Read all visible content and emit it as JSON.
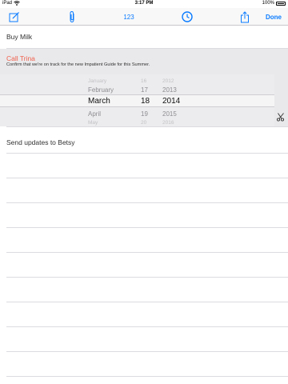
{
  "status_bar": {
    "carrier": "iPad",
    "time": "3:17 PM",
    "battery": "100%"
  },
  "toolbar": {
    "compose_icon": "compose-icon",
    "attach_icon": "paperclip-icon",
    "count_label": "123",
    "clock_icon": "clock-icon",
    "share_icon": "share-icon",
    "done_label": "Done",
    "accent_color": "#0a7bff"
  },
  "tasks": [
    {
      "title": "Buy Milk"
    },
    {
      "title": "Call Trina",
      "note": "Confirm that we're on track for the new Impatient Guide for this Summer.",
      "title_color": "#f0604d"
    },
    {
      "title": "Send updates to Betsy"
    }
  ],
  "date_picker": {
    "months": [
      "January",
      "February",
      "March",
      "April",
      "May"
    ],
    "days": [
      "16",
      "17",
      "18",
      "19",
      "20"
    ],
    "years": [
      "2012",
      "2013",
      "2014",
      "2015",
      "2016"
    ],
    "selected_month": "March",
    "selected_day": "18",
    "selected_year": "2014"
  },
  "scissors_icon": "scissors-icon"
}
